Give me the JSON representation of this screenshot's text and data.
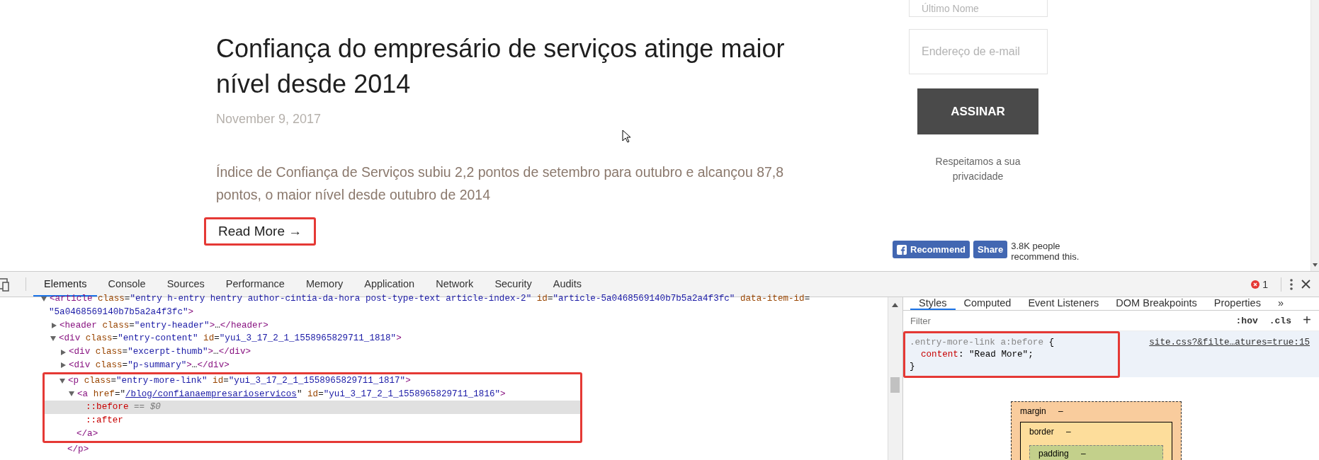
{
  "page": {
    "article": {
      "title": "Confiança do empresário de serviços atinge maior nível desde 2014",
      "date": "November 9, 2017",
      "excerpt": "Índice de Confiança de Serviços subiu 2,2 pontos de setembro para outubro e alcançou 87,8 pontos, o maior nível desde outubro de 2014",
      "read_more": {
        "label": "Read More →",
        "highlighted": true
      }
    },
    "signup": {
      "fields": [
        {
          "placeholder": "Último Nome"
        },
        {
          "placeholder": "Endereço de e-mail"
        }
      ],
      "button": "ASSINAR",
      "note": "Respeitamos a sua privacidade"
    },
    "social": {
      "recommend": "Recommend",
      "share": "Share",
      "count": "3.8K people recommend this."
    }
  },
  "devtools": {
    "tabs": [
      {
        "label": "Elements",
        "selected": true
      },
      {
        "label": "Console",
        "selected": false
      },
      {
        "label": "Sources",
        "selected": false
      },
      {
        "label": "Performance",
        "selected": false
      },
      {
        "label": "Memory",
        "selected": false
      },
      {
        "label": "Application",
        "selected": false
      },
      {
        "label": "Network",
        "selected": false
      },
      {
        "label": "Security",
        "selected": false
      },
      {
        "label": "Audits",
        "selected": false
      }
    ],
    "errors": "1",
    "elements": {
      "tree": [
        {
          "expanded": true,
          "selected": false,
          "lines": [
            [
              {
                "kind": "tag",
                "s": "<article"
              },
              {
                "kind": "attr",
                "s": " class"
              },
              {
                "kind": "punct",
                "s": "="
              },
              {
                "kind": "value",
                "s": "\"entry h-entry hentry author-cintia-da-hora post-type-text article-index-2\""
              },
              {
                "kind": "attr",
                "s": " id"
              },
              {
                "kind": "punct",
                "s": "="
              },
              {
                "kind": "value",
                "s": "\"article-5a0468569140b7b5a2a4f3fc\""
              },
              {
                "kind": "attr",
                "s": " data-item-id"
              },
              {
                "kind": "punct",
                "s": "="
              }
            ],
            [
              {
                "kind": "value",
                "s": "\"5a0468569140b7b5a2a4f3fc\""
              },
              {
                "kind": "tag",
                "s": ">"
              }
            ]
          ],
          "children": [
            {
              "expanded": false,
              "selected": false,
              "lines": [
                [
                  {
                    "kind": "tag",
                    "s": "<header"
                  },
                  {
                    "kind": "attr",
                    "s": " class"
                  },
                  {
                    "kind": "punct",
                    "s": "="
                  },
                  {
                    "kind": "value",
                    "s": "\"entry-header\""
                  },
                  {
                    "kind": "tag",
                    "s": ">"
                  },
                  {
                    "kind": "punct",
                    "s": "…"
                  },
                  {
                    "kind": "tag",
                    "s": "</header>"
                  }
                ]
              ]
            },
            {
              "expanded": true,
              "selected": false,
              "lines": [
                [
                  {
                    "kind": "tag",
                    "s": "<div"
                  },
                  {
                    "kind": "attr",
                    "s": " class"
                  },
                  {
                    "kind": "punct",
                    "s": "="
                  },
                  {
                    "kind": "value",
                    "s": "\"entry-content\""
                  },
                  {
                    "kind": "attr",
                    "s": " id"
                  },
                  {
                    "kind": "punct",
                    "s": "="
                  },
                  {
                    "kind": "value",
                    "s": "\"yui_3_17_2_1_1558965829711_1818\""
                  },
                  {
                    "kind": "tag",
                    "s": ">"
                  }
                ]
              ],
              "children": [
                {
                  "expanded": false,
                  "selected": false,
                  "lines": [
                    [
                      {
                        "kind": "tag",
                        "s": "<div"
                      },
                      {
                        "kind": "attr",
                        "s": " class"
                      },
                      {
                        "kind": "punct",
                        "s": "="
                      },
                      {
                        "kind": "value",
                        "s": "\"excerpt-thumb\""
                      },
                      {
                        "kind": "tag",
                        "s": ">"
                      },
                      {
                        "kind": "punct",
                        "s": "…"
                      },
                      {
                        "kind": "tag",
                        "s": "</div>"
                      }
                    ]
                  ]
                },
                {
                  "expanded": false,
                  "selected": false,
                  "lines": [
                    [
                      {
                        "kind": "tag",
                        "s": "<div"
                      },
                      {
                        "kind": "attr",
                        "s": " class"
                      },
                      {
                        "kind": "punct",
                        "s": "="
                      },
                      {
                        "kind": "value",
                        "s": "\"p-summary\""
                      },
                      {
                        "kind": "tag",
                        "s": ">"
                      },
                      {
                        "kind": "punct",
                        "s": "…"
                      },
                      {
                        "kind": "tag",
                        "s": "</div>"
                      }
                    ]
                  ]
                },
                {
                  "expanded": true,
                  "selected": false,
                  "highlighted": true,
                  "lines": [
                    [
                      {
                        "kind": "tag",
                        "s": "<p"
                      },
                      {
                        "kind": "attr",
                        "s": " class"
                      },
                      {
                        "kind": "punct",
                        "s": "="
                      },
                      {
                        "kind": "value",
                        "s": "\"entry-more-link\""
                      },
                      {
                        "kind": "attr",
                        "s": " id"
                      },
                      {
                        "kind": "punct",
                        "s": "="
                      },
                      {
                        "kind": "value",
                        "s": "\"yui_3_17_2_1_1558965829711_1817\""
                      },
                      {
                        "kind": "tag",
                        "s": ">"
                      }
                    ]
                  ],
                  "close": [
                    {
                      "kind": "tag",
                      "s": "</p>"
                    }
                  ],
                  "children": [
                    {
                      "expanded": true,
                      "selected": false,
                      "lines": [
                        [
                          {
                            "kind": "tag",
                            "s": "<a"
                          },
                          {
                            "kind": "attr",
                            "s": " href"
                          },
                          {
                            "kind": "punct",
                            "s": "=\""
                          },
                          {
                            "kind": "link",
                            "s": "/blog/confianaempresarioservicos"
                          },
                          {
                            "kind": "punct",
                            "s": "\""
                          },
                          {
                            "kind": "attr",
                            "s": " id"
                          },
                          {
                            "kind": "punct",
                            "s": "="
                          },
                          {
                            "kind": "value",
                            "s": "\"yui_3_17_2_1_1558965829711_1816\""
                          },
                          {
                            "kind": "tag",
                            "s": ">"
                          }
                        ]
                      ],
                      "close": [
                        {
                          "kind": "tag",
                          "s": "</a>"
                        }
                      ],
                      "children": [
                        {
                          "selected": true,
                          "lines": [
                            [
                              {
                                "kind": "pseudo",
                                "s": "::before"
                              },
                              {
                                "kind": "note",
                                "s": " == $0"
                              }
                            ]
                          ]
                        },
                        {
                          "selected": false,
                          "lines": [
                            [
                              {
                                "kind": "pseudo",
                                "s": "::after"
                              }
                            ]
                          ]
                        }
                      ]
                    }
                  ]
                }
              ]
            }
          ]
        }
      ]
    },
    "sidebar": {
      "tabs": [
        {
          "label": "Styles",
          "selected": true
        },
        {
          "label": "Computed",
          "selected": false
        },
        {
          "label": "Event Listeners",
          "selected": false
        },
        {
          "label": "DOM Breakpoints",
          "selected": false
        },
        {
          "label": "Properties",
          "selected": false
        }
      ],
      "more": "»",
      "filter": {
        "placeholder": "Filter"
      },
      "hov": ":hov",
      "cls": ".cls",
      "add": "+",
      "rule": {
        "selector": ".entry-more-link a:before",
        "open": "{",
        "source": "site.css?&filte…atures=true:15",
        "declarations": [
          {
            "name": "content",
            "colon": ":",
            "value": "\"Read More\"",
            "end": ";"
          }
        ],
        "close": "}",
        "highlighted": true
      },
      "box_model": [
        {
          "label": "margin –"
        },
        {
          "label": "border –"
        },
        {
          "label": "padding –"
        }
      ]
    }
  }
}
